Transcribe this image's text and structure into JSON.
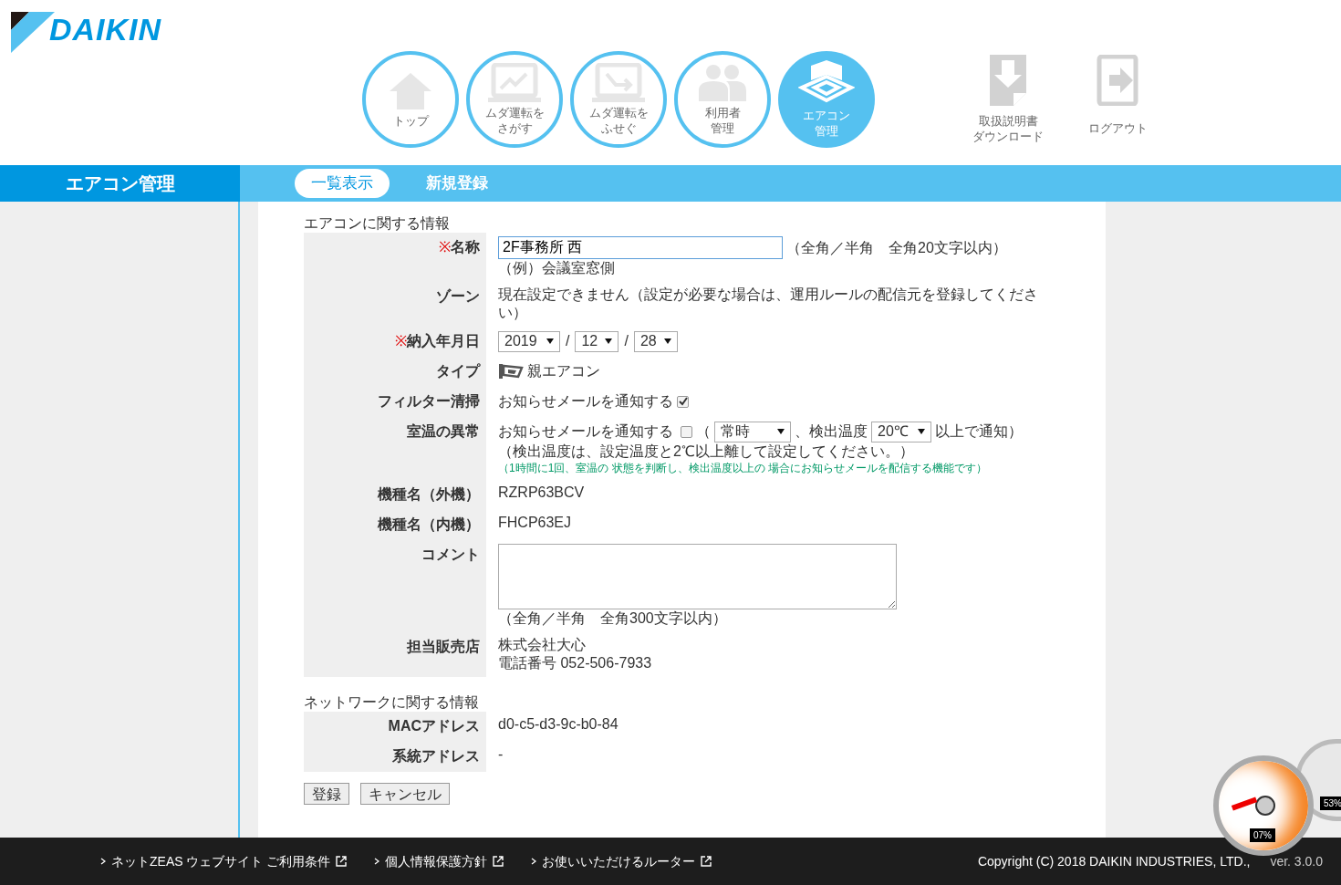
{
  "logo": {
    "text": "DAIKIN"
  },
  "nav": [
    {
      "kind": "home",
      "lines": [
        "トップ"
      ],
      "selected": false
    },
    {
      "kind": "find",
      "lines": [
        "ムダ運転を",
        "さがす"
      ],
      "selected": false
    },
    {
      "kind": "prevent",
      "lines": [
        "ムダ運転を",
        "ふせぐ"
      ],
      "selected": false
    },
    {
      "kind": "users",
      "lines": [
        "利用者",
        "管理"
      ],
      "selected": false
    },
    {
      "kind": "aircon",
      "lines": [
        "エアコン",
        "管理"
      ],
      "selected": true
    }
  ],
  "utility": [
    {
      "kind": "download",
      "lines": [
        "取扱説明書",
        "ダウンロード"
      ]
    },
    {
      "kind": "logout",
      "lines": [
        "ログアウト"
      ]
    }
  ],
  "section_bar": {
    "title": "エアコン管理",
    "tabs": [
      {
        "label": "一覧表示",
        "selected": true
      },
      {
        "label": "新規登録",
        "selected": false
      }
    ]
  },
  "sections": [
    {
      "heading": "エアコンに関する情報",
      "rows": [
        {
          "kind": "input",
          "label": "名称",
          "required_mark": "※",
          "value": "2F事務所 西",
          "note": "（全角／半角　全角20文字以内）",
          "example": "（例）会議室窓側"
        },
        {
          "kind": "text",
          "label": "ゾーン",
          "lines": [
            "現在設定できません（設定が必要な場合は、運用ルールの配信元を登録してくださ",
            "い）"
          ]
        },
        {
          "kind": "date",
          "label": "納入年月日",
          "required_mark": "※",
          "parts": [
            "2019",
            "12",
            "28"
          ],
          "separator": "/"
        },
        {
          "kind": "type",
          "label": "タイプ",
          "value": "親エアコン"
        },
        {
          "kind": "checkbox",
          "label": "フィルター清掃",
          "text": "お知らせメールを通知する",
          "checked": true
        },
        {
          "kind": "alert",
          "label": "室温の異常",
          "text": "お知らせメールを通知する",
          "checked": false,
          "open": "（",
          "select1": "常時",
          "middle": "、検出温度",
          "select2": "20℃",
          "suffix": "以上で通知）",
          "note": "（検出温度は、設定温度と2℃以上離して設定してください。）",
          "info": "（1時間に1回、室温の 状態を判断し、検出温度以上の 場合にお知らせメールを配信する機能です）"
        },
        {
          "kind": "text",
          "label": "機種名（外機）",
          "lines": [
            "RZRP63BCV"
          ]
        },
        {
          "kind": "text",
          "label": "機種名（内機）",
          "lines": [
            "FHCP63EJ"
          ]
        },
        {
          "kind": "textarea",
          "label": "コメント",
          "note": "（全角／半角　全角300文字以内）"
        },
        {
          "kind": "text",
          "label": "担当販売店",
          "lines": [
            "株式会社大心",
            "電話番号 052-506-7933"
          ]
        }
      ]
    },
    {
      "heading": "ネットワークに関する情報",
      "rows": [
        {
          "kind": "text",
          "label": "**MAC**アドレス",
          "lines": [
            "d0-c5-d3-9c-b0-84"
          ]
        },
        {
          "kind": "text",
          "label": "系統アドレス",
          "lines": [
            "-"
          ]
        }
      ]
    }
  ],
  "buttons": [
    "登録",
    "キャンセル"
  ],
  "footer": {
    "links": [
      "ネットZEAS ウェブサイト ご利用条件",
      "個人情報保護方針",
      "お使いいただけるルーター"
    ],
    "copyright": "Copyright (C) 2018 DAIKIN INDUSTRIES, LTD.,",
    "version": "ver. 3.0.0"
  },
  "gadget": {
    "readings": [
      "07%",
      "53%"
    ]
  }
}
